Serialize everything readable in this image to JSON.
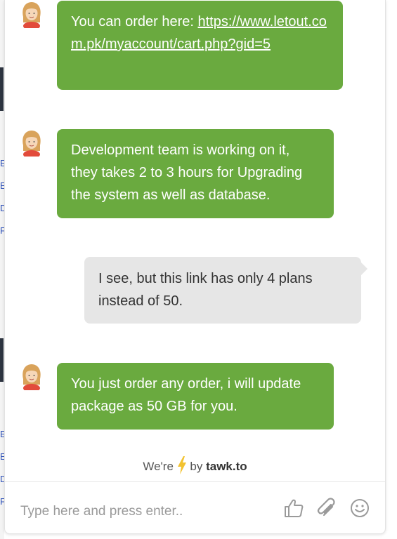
{
  "messages": [
    {
      "sender": "agent",
      "text": "You can order here: ",
      "link": "https://www.letout.com.pk/myaccount/cart.php?gid=5"
    },
    {
      "sender": "agent",
      "text": "Development team is working on it, they takes 2 to 3 hours for Upgrading the system as well as database."
    },
    {
      "sender": "visitor",
      "text": "I see, but this link has only 4 plans instead of 50."
    },
    {
      "sender": "agent",
      "text": "You just order any order, i will update package as 50 GB for you."
    }
  ],
  "branding": {
    "prefix": "We're",
    "by": "by",
    "brand": "tawk.to"
  },
  "composer": {
    "placeholder": "Type here and press enter..",
    "icons": [
      "thumbs-up-icon",
      "paperclip-icon",
      "emoji-icon"
    ]
  },
  "colors": {
    "agent_bubble": "#6aaa3f",
    "visitor_bubble": "#e6e6e6",
    "bolt": "#f2c230"
  }
}
